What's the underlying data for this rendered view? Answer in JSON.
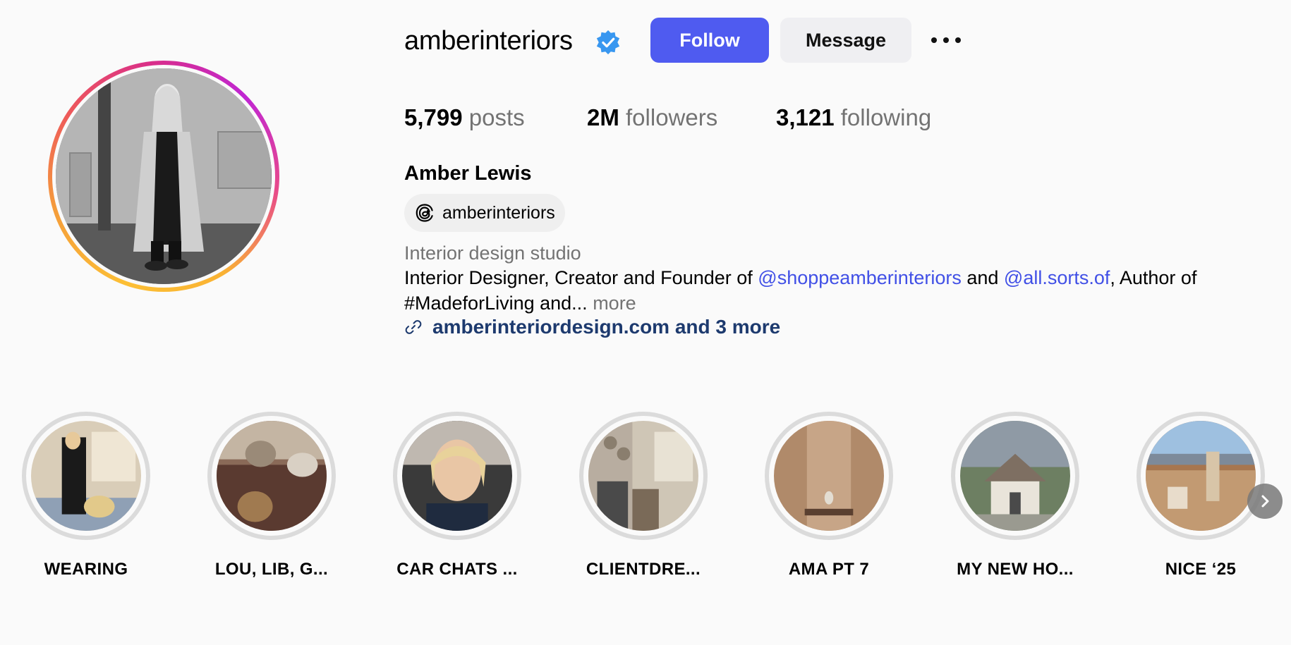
{
  "profile": {
    "username": "amberinteriors",
    "verified": true,
    "full_name": "Amber Lewis",
    "threads_handle": "amberinteriors",
    "category": "Interior design studio",
    "bio": {
      "part1": "Interior Designer, Creator and Founder of ",
      "mention1": "@shoppeamberinteriors",
      "part2": " and ",
      "mention2": "@all.sorts.of",
      "part3": ", Author of #MadeforLiving and...",
      "more": "more"
    },
    "link_text": "amberinteriordesign.com and 3 more"
  },
  "actions": {
    "follow_label": "Follow",
    "message_label": "Message"
  },
  "stats": {
    "posts_count": "5,799",
    "posts_label": "posts",
    "followers_count": "2M",
    "followers_label": "followers",
    "following_count": "3,121",
    "following_label": "following"
  },
  "highlights": [
    {
      "title": "WEARING"
    },
    {
      "title": "LOU, LIB, G..."
    },
    {
      "title": "CAR CHATS ..."
    },
    {
      "title": "CLIENTDRE..."
    },
    {
      "title": "AMA PT 7"
    },
    {
      "title": "MY NEW HO..."
    },
    {
      "title": "NICE ‘25"
    }
  ],
  "colors": {
    "accent": "#4f5bf0",
    "mention": "#4150e6",
    "link": "#1d3a6e",
    "verified_badge": "#3897f0",
    "secondary_text": "#737373"
  },
  "icons": {
    "verified": "verified-badge-icon",
    "threads": "threads-icon",
    "link": "link-icon",
    "more": "more-options-icon",
    "next": "chevron-right-icon"
  }
}
